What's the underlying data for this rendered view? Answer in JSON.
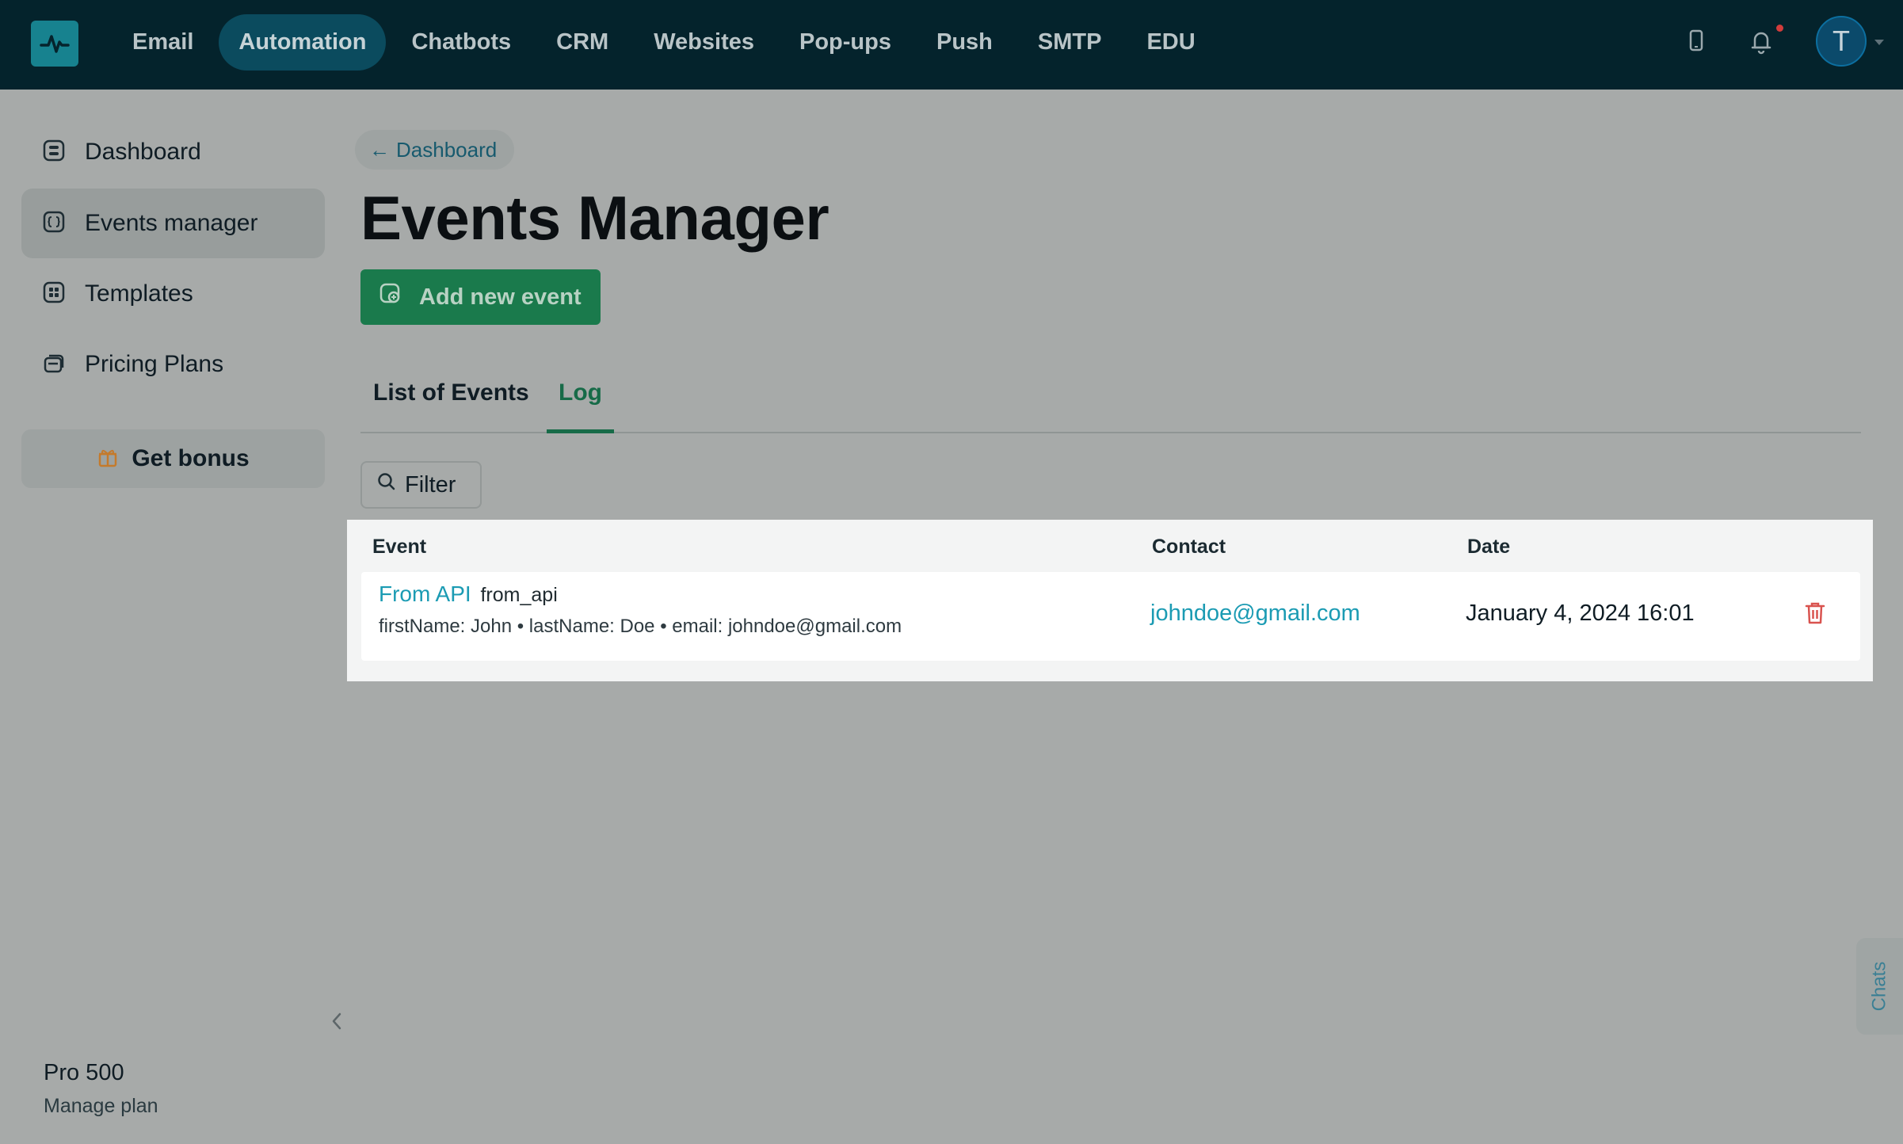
{
  "topnav": {
    "items": [
      "Email",
      "Automation",
      "Chatbots",
      "CRM",
      "Websites",
      "Pop-ups",
      "Push",
      "SMTP",
      "EDU"
    ],
    "active": "Automation",
    "avatar_initial": "T",
    "icons": [
      "logo-pulse-icon",
      "mobile-icon",
      "bell-icon"
    ]
  },
  "sidebar": {
    "items": [
      {
        "label": "Dashboard",
        "icon": "dashboard-icon"
      },
      {
        "label": "Events manager",
        "icon": "events-icon",
        "active": true
      },
      {
        "label": "Templates",
        "icon": "templates-icon"
      },
      {
        "label": "Pricing Plans",
        "icon": "pricing-icon"
      }
    ],
    "bonus_label": "Get bonus",
    "plan_name": "Pro 500",
    "plan_link": "Manage plan"
  },
  "main": {
    "breadcrumb": "Dashboard",
    "title": "Events Manager",
    "add_button": "Add new event",
    "tabs": [
      "List of Events",
      "Log"
    ],
    "active_tab": "Log",
    "filter_label": "Filter",
    "table": {
      "headers": [
        "Event",
        "Contact",
        "Date"
      ],
      "rows": [
        {
          "event_name": "From API",
          "event_key": "from_api",
          "params": "firstName: John • lastName: Doe • email: johndoe@gmail.com",
          "contact": "johndoe@gmail.com",
          "date": "January 4, 2024 16:01"
        }
      ]
    }
  },
  "chats_label": "Chats",
  "colors": {
    "topbar": "#04232c",
    "accent_green": "#1a7a4c",
    "link": "#1b9bb3",
    "danger": "#d9534f"
  }
}
